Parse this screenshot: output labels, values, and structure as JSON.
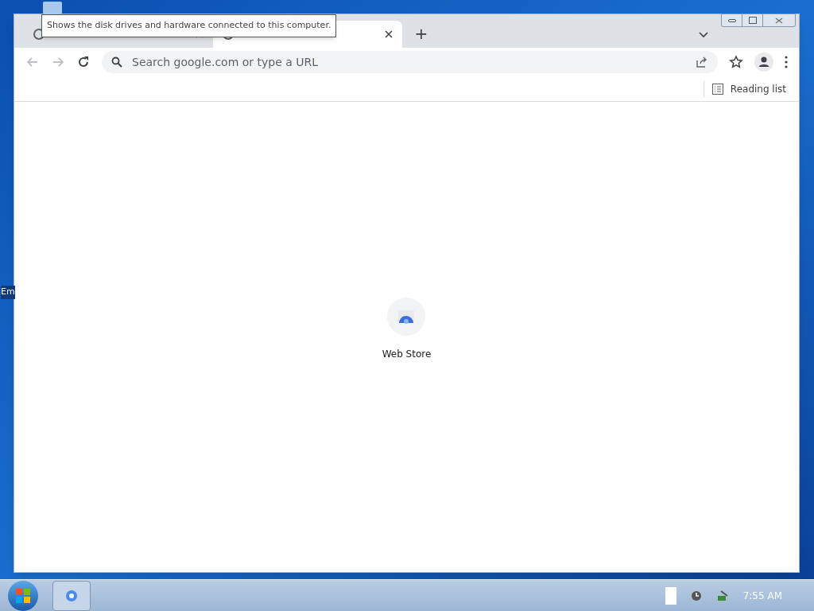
{
  "desktop": {
    "icon_label": "Em"
  },
  "tooltip": {
    "text": "Shows the disk drives and hardware connected to this computer."
  },
  "tabs": [
    {
      "selected": false
    },
    {
      "selected": true
    }
  ],
  "new_tab": "+",
  "omnibox": {
    "placeholder": "Search google.com or type a URL"
  },
  "bookmarks_bar": {
    "reading_list": "Reading list"
  },
  "shortcuts": [
    {
      "label": "Web Store"
    }
  ],
  "taskbar": {
    "clock": "7:55 AM"
  }
}
